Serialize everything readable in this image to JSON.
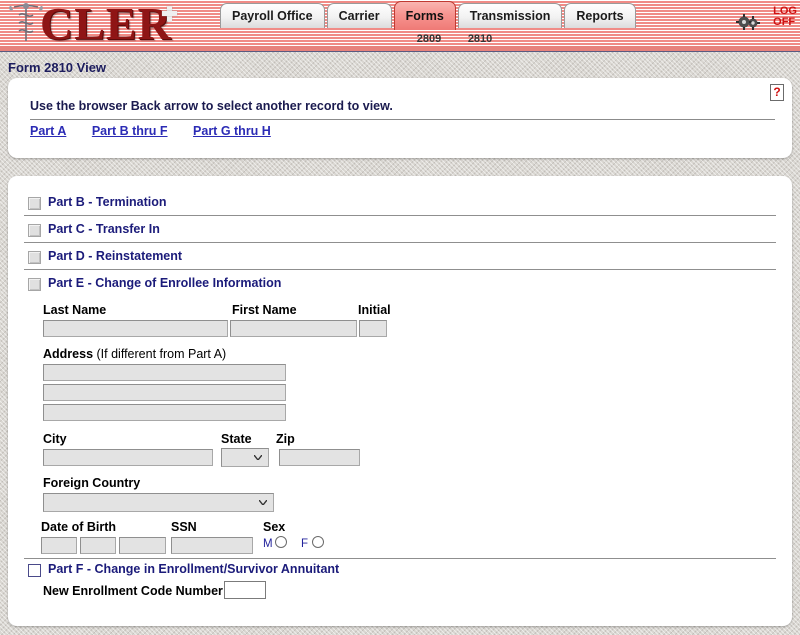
{
  "app": {
    "logo_text": "CLER",
    "logoff_line1": "LOG",
    "logoff_line2": "OFF"
  },
  "nav": {
    "tabs": [
      {
        "label": "Payroll Office",
        "active": false
      },
      {
        "label": "Carrier",
        "active": false
      },
      {
        "label": "Forms",
        "active": true
      },
      {
        "label": "Transmission",
        "active": false
      },
      {
        "label": "Reports",
        "active": false
      }
    ],
    "subtabs": [
      {
        "label": "2809"
      },
      {
        "label": "2810"
      }
    ]
  },
  "page": {
    "title": "Form 2810 View",
    "instruction": "Use the browser Back arrow to select another record to view.",
    "part_links": [
      {
        "label": "Part A"
      },
      {
        "label": "Part B thru F"
      },
      {
        "label": "Part G thru H"
      }
    ]
  },
  "parts": [
    {
      "id": "b",
      "label": "Part B - Termination",
      "checkbox": "disabled",
      "checked": false
    },
    {
      "id": "c",
      "label": "Part C - Transfer In",
      "checkbox": "disabled",
      "checked": false
    },
    {
      "id": "d",
      "label": "Part D - Reinstatement",
      "checkbox": "disabled",
      "checked": false
    },
    {
      "id": "e",
      "label": "Part E - Change of Enrollee Information",
      "checkbox": "disabled",
      "checked": false
    },
    {
      "id": "f",
      "label": "Part F - Change in Enrollment/Survivor Annuitant",
      "checkbox": "enabled",
      "checked": false
    }
  ],
  "part_e": {
    "last_name_label": "Last Name",
    "last_name_value": "",
    "first_name_label": "First Name",
    "first_name_value": "",
    "initial_label": "Initial",
    "initial_value": "",
    "address_label": "Address",
    "address_note": "(If different from Part A)",
    "address_line1": "",
    "address_line2": "",
    "address_line3": "",
    "city_label": "City",
    "city_value": "",
    "state_label": "State",
    "state_value": "",
    "zip_label": "Zip",
    "zip_value": "",
    "foreign_country_label": "Foreign Country",
    "foreign_country_value": "",
    "dob_label": "Date of Birth",
    "dob_month": "",
    "dob_day": "",
    "dob_year": "",
    "ssn_label": "SSN",
    "ssn_value": "",
    "sex_label": "Sex",
    "sex_male_label": "M",
    "sex_female_label": "F",
    "sex_selected": ""
  },
  "part_f": {
    "enrollment_code_label": "New Enrollment Code Number",
    "enrollment_code_value": ""
  },
  "colors": {
    "banner_pink": "#f08b86",
    "logo_red": "#8f1515",
    "link_blue": "#2b2bb5",
    "heading_blue": "#1b1b7a",
    "logoff_red": "#cf1111",
    "active_tab": "#ef7a76"
  }
}
